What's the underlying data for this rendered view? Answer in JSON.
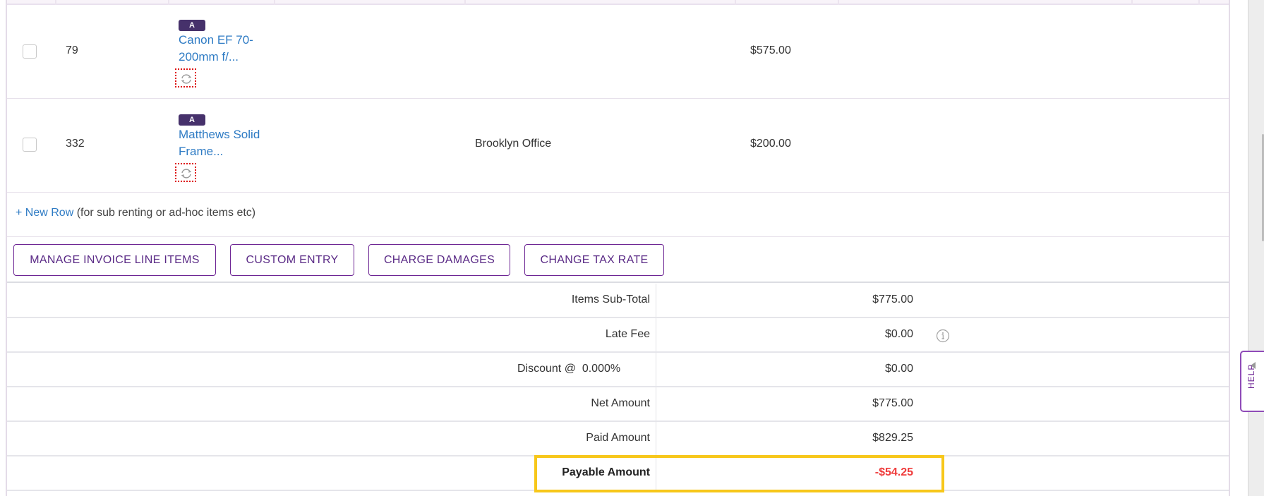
{
  "items": [
    {
      "id": "79",
      "badge": "A",
      "name": "Canon EF 70-200mm f/...",
      "location": "",
      "price": "$575.00"
    },
    {
      "id": "332",
      "badge": "A",
      "name": "Matthews Solid Frame...",
      "location": "Brooklyn Office",
      "price": "$200.00"
    }
  ],
  "new_row": {
    "link_label": "+ New Row",
    "hint": " (for sub renting or ad-hoc items etc)"
  },
  "actions": {
    "manage_line_items": "MANAGE INVOICE LINE ITEMS",
    "custom_entry": "CUSTOM ENTRY",
    "charge_damages": "CHARGE DAMAGES",
    "change_tax_rate": "CHANGE TAX RATE"
  },
  "summary": {
    "items_subtotal": {
      "label": "Items Sub-Total",
      "value": "$775.00"
    },
    "late_fee": {
      "label": "Late Fee",
      "value": "$0.00",
      "icon": "info-icon"
    },
    "discount": {
      "label": "Discount @  0.000%",
      "value": "$0.00"
    },
    "net_amount": {
      "label": "Net Amount",
      "value": "$775.00"
    },
    "paid_amount": {
      "label": "Paid Amount",
      "value": "$829.25"
    },
    "payable_amount": {
      "label": "Payable Amount",
      "value": "-$54.25"
    }
  },
  "help": {
    "label": "HELP"
  },
  "colors": {
    "brand_purple": "#6d2594",
    "badge": "#46316b",
    "link": "#2e7bc4",
    "negative": "#ef3b3b",
    "highlight": "#f7c71a"
  }
}
